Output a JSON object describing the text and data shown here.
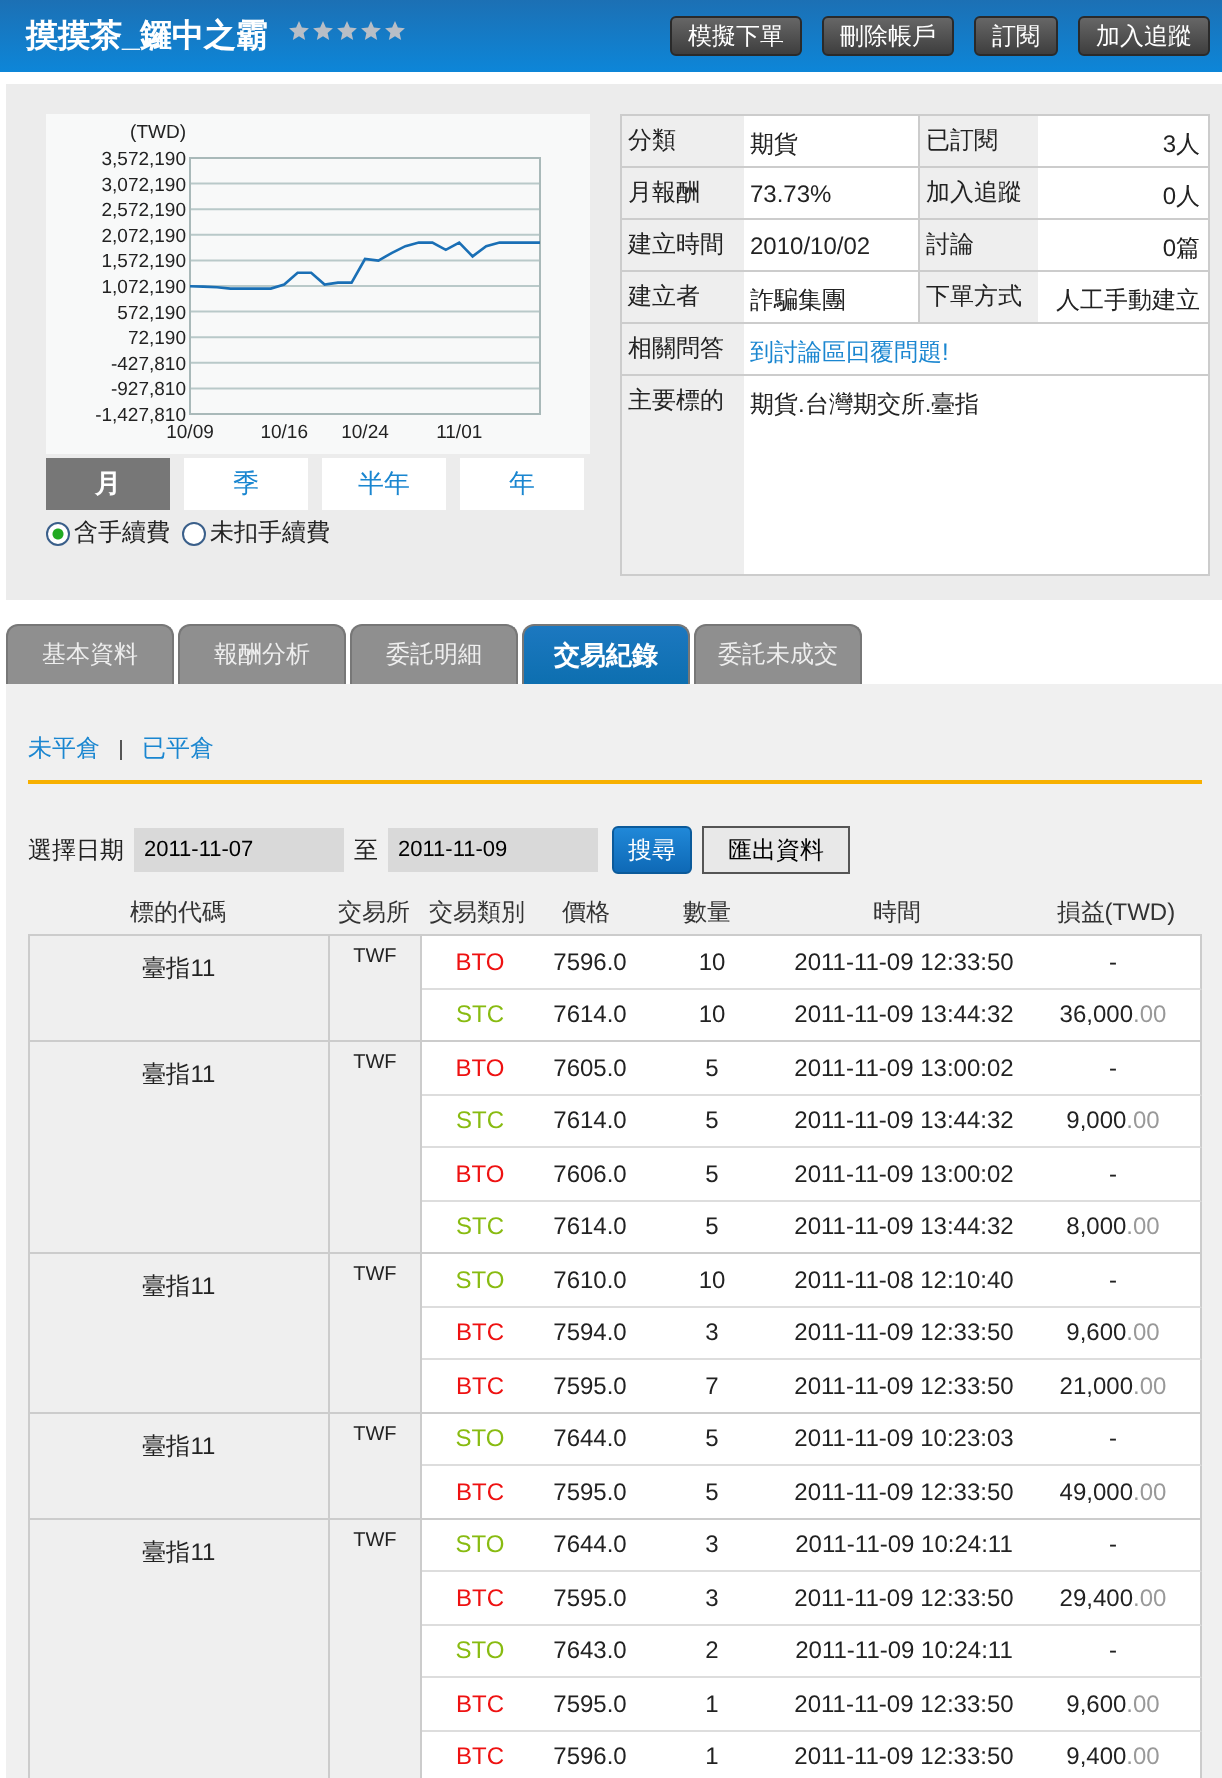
{
  "header": {
    "title": "摸摸茶_鑼中之霸",
    "buttons": [
      "模擬下單",
      "刪除帳戶",
      "訂閱",
      "加入追蹤"
    ]
  },
  "chart": {
    "chart_data": {
      "type": "line",
      "grid": true,
      "ylabel": "(TWD)",
      "categories": [
        "10/09",
        null,
        null,
        null,
        null,
        null,
        null,
        "10/16",
        null,
        null,
        null,
        null,
        null,
        "10/24",
        null,
        null,
        null,
        null,
        null,
        null,
        "11/01",
        null,
        null,
        null,
        null,
        null,
        null
      ],
      "series": [
        {
          "color": "#1a6fb5",
          "values": [
            1070000,
            1060000,
            1050000,
            1020000,
            1020000,
            1020000,
            1020000,
            1100000,
            1330000,
            1330000,
            1100000,
            1140000,
            1140000,
            1600000,
            1570000,
            1720000,
            1850000,
            1920000,
            1920000,
            1780000,
            1920000,
            1650000,
            1850000,
            1920000,
            1920000,
            1920000,
            1920000
          ]
        }
      ],
      "ylim": [
        -1427810,
        3572190
      ],
      "yticks": [
        {
          "value": 3572190,
          "label": "3,572,190"
        },
        {
          "value": 3072190,
          "label": "3,072,190"
        },
        {
          "value": 2572190,
          "label": "2,572,190"
        },
        {
          "value": 2072190,
          "label": "2,072,190"
        },
        {
          "value": 1572190,
          "label": "1,572,190"
        },
        {
          "value": 1072190,
          "label": "1,072,190"
        },
        {
          "value": 572190,
          "label": "572,190"
        },
        {
          "value": 72190,
          "label": "72,190"
        },
        {
          "value": -427810,
          "label": "-427,810"
        },
        {
          "value": -927810,
          "label": "-927,810"
        },
        {
          "value": -1427810,
          "label": "-1,427,810"
        }
      ]
    }
  },
  "periods": [
    {
      "label": "月",
      "selected": true
    },
    {
      "label": "季",
      "selected": false
    },
    {
      "label": "半年",
      "selected": false
    },
    {
      "label": "年",
      "selected": false
    }
  ],
  "fee_options": [
    {
      "label": "含手續費",
      "selected": true
    },
    {
      "label": "未扣手續費",
      "selected": false
    }
  ],
  "info": {
    "pairs": [
      {
        "label": "分類",
        "value": "期貨",
        "label2": "已訂閱",
        "value2": "3人"
      },
      {
        "label": "月報酬",
        "value": "73.73%",
        "label2": "加入追蹤",
        "value2": "0人"
      },
      {
        "label": "建立時間",
        "value": "2010/10/02",
        "label2": "討論",
        "value2": "0篇"
      },
      {
        "label": "建立者",
        "value": "詐騙集團",
        "label2": "下單方式",
        "value2": "人工手動建立"
      }
    ],
    "qa_label": "相關問答",
    "qa_link": "到討論區回覆問題!",
    "target_label": "主要標的",
    "target_value": "期貨.台灣期交所.臺指"
  },
  "tabs": [
    {
      "label": "基本資料",
      "selected": false
    },
    {
      "label": "報酬分析",
      "selected": false
    },
    {
      "label": "委託明細",
      "selected": false
    },
    {
      "label": "交易紀錄",
      "selected": true
    },
    {
      "label": "委託未成交",
      "selected": false
    }
  ],
  "sub_links": [
    "未平倉",
    "已平倉"
  ],
  "filter": {
    "label": "選擇日期",
    "from": "2011-11-07",
    "to_label": "至",
    "to": "2011-11-09",
    "search_button": "搜尋",
    "export_button": "匯出資料"
  },
  "table": {
    "columns": [
      "標的代碼",
      "交易所",
      "交易類別",
      "價格",
      "數量",
      "時間",
      "損益(TWD)"
    ],
    "groups": [
      {
        "symbol": "臺指11",
        "exchange": "TWF",
        "trades": [
          {
            "type": "BTO",
            "color": "#ee1111",
            "price": "7596.0",
            "qty": "10",
            "time": "2011-11-09 12:33:50",
            "pnl": "-"
          },
          {
            "type": "STC",
            "color": "#88bb11",
            "price": "7614.0",
            "qty": "10",
            "time": "2011-11-09 13:44:32",
            "pnl": "36,000",
            "pnl_decimals": ".00"
          }
        ]
      },
      {
        "symbol": "臺指11",
        "exchange": "TWF",
        "trades": [
          {
            "type": "BTO",
            "color": "#ee1111",
            "price": "7605.0",
            "qty": "5",
            "time": "2011-11-09 13:00:02",
            "pnl": "-"
          },
          {
            "type": "STC",
            "color": "#88bb11",
            "price": "7614.0",
            "qty": "5",
            "time": "2011-11-09 13:44:32",
            "pnl": "9,000",
            "pnl_decimals": ".00"
          },
          {
            "type": "BTO",
            "color": "#ee1111",
            "price": "7606.0",
            "qty": "5",
            "time": "2011-11-09 13:00:02",
            "pnl": "-"
          },
          {
            "type": "STC",
            "color": "#88bb11",
            "price": "7614.0",
            "qty": "5",
            "time": "2011-11-09 13:44:32",
            "pnl": "8,000",
            "pnl_decimals": ".00"
          }
        ]
      },
      {
        "symbol": "臺指11",
        "exchange": "TWF",
        "trades": [
          {
            "type": "STO",
            "color": "#88bb11",
            "price": "7610.0",
            "qty": "10",
            "time": "2011-11-08 12:10:40",
            "pnl": "-"
          },
          {
            "type": "BTC",
            "color": "#ee1111",
            "price": "7594.0",
            "qty": "3",
            "time": "2011-11-09 12:33:50",
            "pnl": "9,600",
            "pnl_decimals": ".00"
          },
          {
            "type": "BTC",
            "color": "#ee1111",
            "price": "7595.0",
            "qty": "7",
            "time": "2011-11-09 12:33:50",
            "pnl": "21,000",
            "pnl_decimals": ".00"
          }
        ]
      },
      {
        "symbol": "臺指11",
        "exchange": "TWF",
        "trades": [
          {
            "type": "STO",
            "color": "#88bb11",
            "price": "7644.0",
            "qty": "5",
            "time": "2011-11-09 10:23:03",
            "pnl": "-"
          },
          {
            "type": "BTC",
            "color": "#ee1111",
            "price": "7595.0",
            "qty": "5",
            "time": "2011-11-09 12:33:50",
            "pnl": "49,000",
            "pnl_decimals": ".00"
          }
        ]
      },
      {
        "symbol": "臺指11",
        "exchange": "TWF",
        "trades": [
          {
            "type": "STO",
            "color": "#88bb11",
            "price": "7644.0",
            "qty": "3",
            "time": "2011-11-09 10:24:11",
            "pnl": "-"
          },
          {
            "type": "BTC",
            "color": "#ee1111",
            "price": "7595.0",
            "qty": "3",
            "time": "2011-11-09 12:33:50",
            "pnl": "29,400",
            "pnl_decimals": ".00"
          },
          {
            "type": "STO",
            "color": "#88bb11",
            "price": "7643.0",
            "qty": "2",
            "time": "2011-11-09 10:24:11",
            "pnl": "-"
          },
          {
            "type": "BTC",
            "color": "#ee1111",
            "price": "7595.0",
            "qty": "1",
            "time": "2011-11-09 12:33:50",
            "pnl": "9,600",
            "pnl_decimals": ".00"
          },
          {
            "type": "BTC",
            "color": "#ee1111",
            "price": "7596.0",
            "qty": "1",
            "time": "2011-11-09 12:33:50",
            "pnl": "9,400",
            "pnl_decimals": ".00"
          }
        ]
      }
    ]
  }
}
